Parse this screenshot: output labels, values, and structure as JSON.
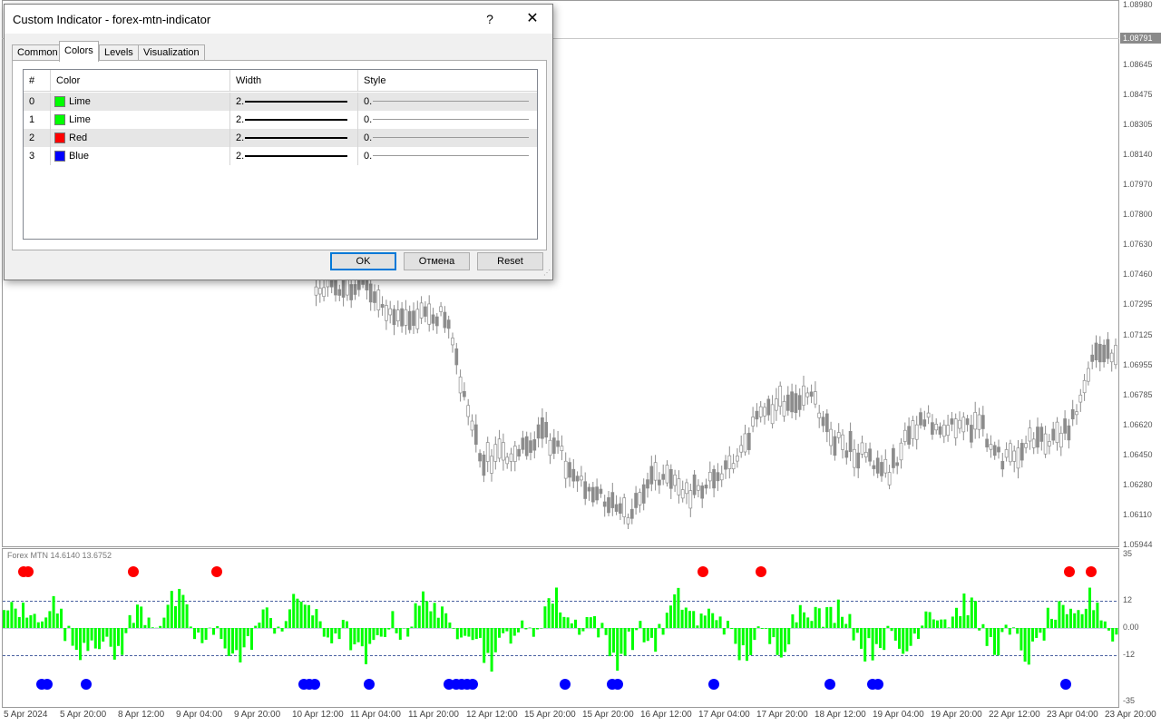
{
  "dialog": {
    "title": "Custom Indicator - forex-mtn-indicator",
    "help_label": "?",
    "close_label": "✕",
    "tabs": [
      "Common",
      "Colors",
      "Levels",
      "Visualization"
    ],
    "active_tab": "Colors",
    "columns": [
      "#",
      "Color",
      "Width",
      "Style"
    ],
    "rows": [
      {
        "index": "0",
        "color_name": "Lime",
        "color_hex": "#00ff00",
        "width": "2.",
        "style": "0."
      },
      {
        "index": "1",
        "color_name": "Lime",
        "color_hex": "#00ff00",
        "width": "2.",
        "style": "0."
      },
      {
        "index": "2",
        "color_name": "Red",
        "color_hex": "#ff0000",
        "width": "2.",
        "style": "0."
      },
      {
        "index": "3",
        "color_name": "Blue",
        "color_hex": "#0000ff",
        "width": "2.",
        "style": "0."
      }
    ],
    "buttons": {
      "ok": "OK",
      "cancel": "Отмена",
      "reset": "Reset"
    }
  },
  "chart": {
    "current_price": "1.08791",
    "price_ticks": [
      "1.08980",
      "1.08791",
      "1.08645",
      "1.08475",
      "1.08305",
      "1.08140",
      "1.07970",
      "1.07800",
      "1.07630",
      "1.07460",
      "1.07295",
      "1.07125",
      "1.06955",
      "1.06785",
      "1.06620",
      "1.06450",
      "1.06280",
      "1.06110",
      "1.05944"
    ],
    "oscillator_label": "Forex MTN 14.6140 13.6752",
    "oscillator_ticks": [
      "35",
      "12",
      "0.00",
      "-12",
      "-35"
    ],
    "time_ticks": [
      "5 Apr 2024",
      "5 Apr 20:00",
      "8 Apr 12:00",
      "9 Apr 04:00",
      "9 Apr 20:00",
      "10 Apr 12:00",
      "11 Apr 04:00",
      "11 Apr 20:00",
      "12 Apr 12:00",
      "15 Apr 20:00",
      "15 Apr 20:00",
      "16 Apr 12:00",
      "17 Apr 04:00",
      "17 Apr 20:00",
      "18 Apr 12:00",
      "19 Apr 04:00",
      "19 Apr 20:00",
      "22 Apr 12:00",
      "23 Apr 04:00",
      "23 Apr 20:00"
    ],
    "colors": {
      "candle": "#8c8c8c",
      "histogram": "#00ff00",
      "signal_up": "#ff0000",
      "signal_down": "#0000ff",
      "level_line": "#1e3a8a"
    }
  }
}
